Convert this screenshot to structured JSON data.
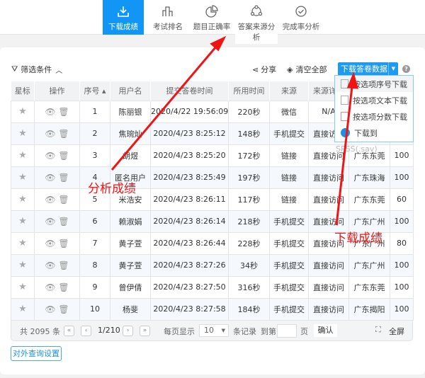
{
  "nav": {
    "tabs": [
      {
        "label": "下载成绩",
        "icon": "download-icon",
        "active": true
      },
      {
        "label": "考试排名",
        "icon": "bar-chart-icon"
      },
      {
        "label": "题目正确率",
        "icon": "pie-chart-icon"
      },
      {
        "label": "答案来源分析",
        "icon": "share-nodes-icon"
      },
      {
        "label": "完成率分析",
        "icon": "check-circle-icon"
      }
    ]
  },
  "toolbar": {
    "filter": "筛选条件",
    "share": "分享",
    "clear": "清空全部",
    "download": "下载答卷数据"
  },
  "dropdown": {
    "items": [
      "按选项序号下载",
      "按选项文本下载",
      "按选项分数下载",
      "下载到"
    ],
    "spss": "SPSS(.sav)"
  },
  "table": {
    "headers": [
      "星标",
      "操作",
      "序号",
      "用户名",
      "提交答卷时间",
      "所用时间",
      "来源",
      "来源详情",
      "",
      ""
    ],
    "rows": [
      [
        "1",
        "陈丽银",
        "2020/4/22 19:56:09",
        "220秒",
        "微信",
        "N/A",
        "",
        ""
      ],
      [
        "2",
        "焦琬灿",
        "2020/4/23 8:25:12",
        "148秒",
        "手机提交",
        "直接访问",
        "",
        ""
      ],
      [
        "3",
        "胡煜",
        "2020/4/23 8:25:20",
        "172秒",
        "链接",
        "直接访问",
        "广东东莞",
        "100"
      ],
      [
        "4",
        "匿名用户",
        "2020/4/23 8:25:49",
        "197秒",
        "链接",
        "直接访问",
        "广东珠海",
        "100"
      ],
      [
        "5",
        "米浩安",
        "2020/4/23 8:26:11",
        "117秒",
        "链接",
        "直接访问",
        "广东东莞",
        "60"
      ],
      [
        "6",
        "赖淑娟",
        "2020/4/23 8:26:14",
        "218秒",
        "手机提交",
        "直接访问",
        "广东广州",
        "100"
      ],
      [
        "7",
        "黄子萱",
        "2020/4/23 8:26:44",
        "228秒",
        "手机提交",
        "直接访问",
        "广东广州",
        "80"
      ],
      [
        "8",
        "黄子萱",
        "2020/4/23 8:27:26",
        "34秒",
        "手机提交",
        "直接访问",
        "广东广州",
        "100"
      ],
      [
        "9",
        "曾伊倩",
        "2020/4/23 8:27:50",
        "316秒",
        "手机提交",
        "直接访问",
        "广东东莞",
        "100"
      ],
      [
        "10",
        "杨斐",
        "2020/4/23 8:27:58",
        "184秒",
        "手机提交",
        "直接访问",
        "广东揭阳",
        "100"
      ]
    ]
  },
  "footer": {
    "total": "共 2095 条",
    "page": "1/210",
    "per_page_label": "每页显示",
    "per_page": "10",
    "records": "条记录",
    "goto": "到第",
    "page_unit": "页",
    "confirm": "确认",
    "fullscreen": "全屏"
  },
  "query_settings": "对外查询设置",
  "annotations": {
    "left": "分析成绩",
    "right": "下载成绩"
  },
  "colors": {
    "accent": "#1296f5",
    "annotation": "#f01414"
  }
}
